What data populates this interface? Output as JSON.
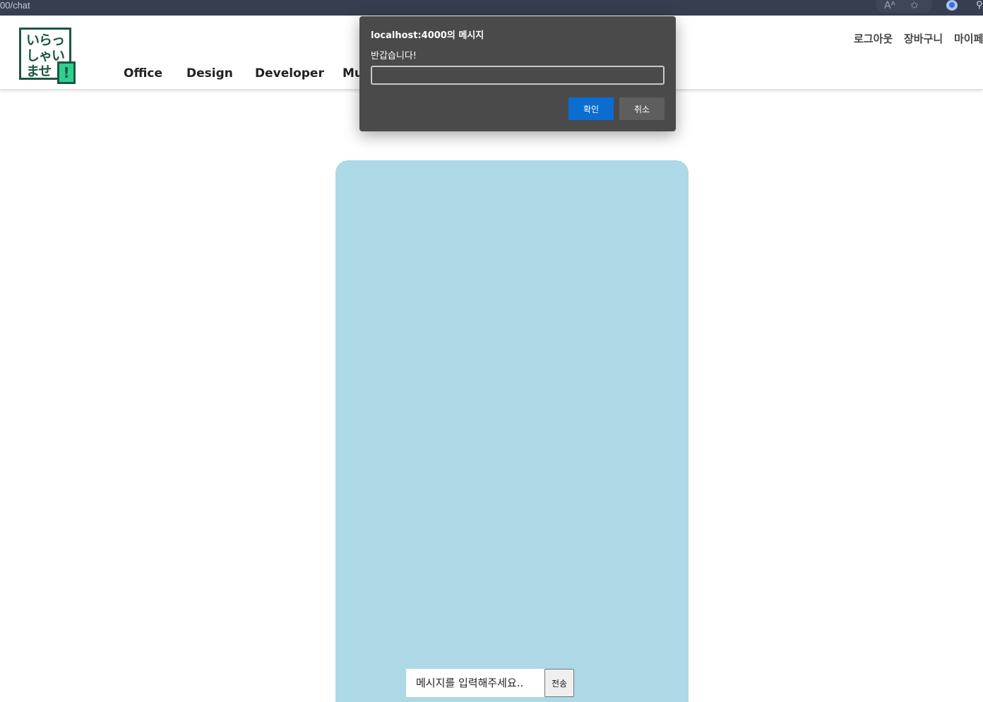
{
  "browser": {
    "url_fragment": "00/chat",
    "read_aloud_icon": "Aᴬ",
    "favorites_icon": "✩",
    "extension_icon": "⚲"
  },
  "header": {
    "logo": {
      "line1": "いらっ",
      "line2": "しゃい",
      "line3": "ませ",
      "mark": "!"
    },
    "nav": [
      "Office",
      "Design",
      "Developer",
      "Mu"
    ],
    "utility_links": [
      "로그아웃",
      "장바구니",
      "마이페"
    ]
  },
  "dialog": {
    "title": "localhost:4000의 메시지",
    "message": "반갑습니다!",
    "input_value": "",
    "ok_label": "확인",
    "cancel_label": "취소"
  },
  "chat": {
    "input_placeholder": "메시지를 입력해주세요..",
    "send_label": "전송"
  },
  "colors": {
    "chat_panel": "#add8e6",
    "dialog_bg": "#4a4a4a",
    "ok_button": "#0a6ed1",
    "logo_green": "#1e5645",
    "logo_accent": "#2fd08f"
  }
}
